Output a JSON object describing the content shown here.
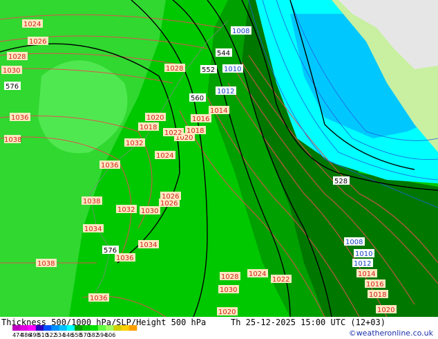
{
  "title": "Thickness 500/1000 hPa/SLP/Height 500 hPa",
  "valid_time": "Th 25-12-2025 15:00 UTC (12+03)",
  "credit": "©weatheronline.co.uk",
  "legend": {
    "ticks": [
      "474",
      "486",
      "498",
      "510",
      "522",
      "534",
      "546",
      "558",
      "570",
      "582",
      "594",
      "606"
    ],
    "colors": [
      "#c000c0",
      "#e000e0",
      "#ff00ff",
      "#3000c0",
      "#0050ff",
      "#0090ff",
      "#00c0ff",
      "#00ffff",
      "#00a000",
      "#00c800",
      "#00e000",
      "#60ff40",
      "#a0ff60",
      "#d0d000",
      "#ffd000",
      "#ffa000"
    ]
  },
  "slp_labels": [
    "1024",
    "1026",
    "1028",
    "1030",
    "1036",
    "1038",
    "1036",
    "1038",
    "1036",
    "1034",
    "1032",
    "1030",
    "1032",
    "1034",
    "1036",
    "1038",
    "1020",
    "1018",
    "1020",
    "1022",
    "1024",
    "1026",
    "1028",
    "1026",
    "1022",
    "1018",
    "1020",
    "1016",
    "1014",
    "1012",
    "1010",
    "1008",
    "1008",
    "1012",
    "1014",
    "1012",
    "1010",
    "1008",
    "1010",
    "1012",
    "1014",
    "1016",
    "1018",
    "1020",
    "1024",
    "1022",
    "1026",
    "1028",
    "1030",
    "1026",
    "1018"
  ],
  "height_labels": [
    "576",
    "560",
    "552",
    "576",
    "528",
    "544"
  ],
  "colors": {
    "zone_576_plus": "#00c800",
    "zone_558": "#00a000",
    "zone_552": "#007800",
    "zone_cold": "#00ffff",
    "zone_colder": "#00c8ff",
    "land": "#c8f0a0",
    "grey": "#e6e6e6",
    "slp_line": "#e05050",
    "thick_blue": "#2060e0",
    "geopot": "#000000"
  }
}
